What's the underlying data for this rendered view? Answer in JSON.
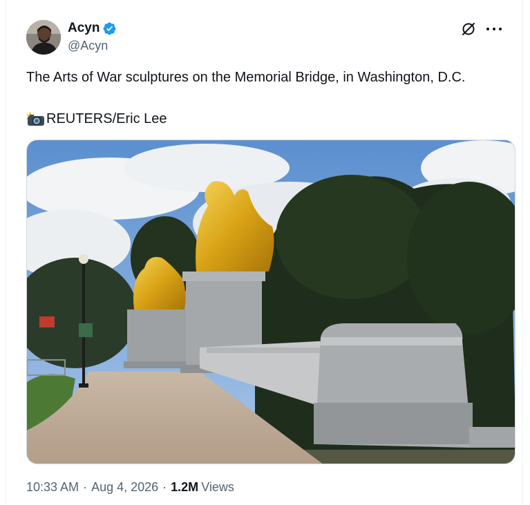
{
  "tweet": {
    "author": {
      "display_name": "Acyn",
      "handle": "@Acyn",
      "verified": true,
      "avatar_icon": "user-avatar"
    },
    "actions": {
      "grok_icon": "grok-slash-icon",
      "more_icon": "more-dots-icon"
    },
    "text": "The Arts of War sculptures on the Memorial Bridge, in Washington, D.C.",
    "credit": "REUTERS/Eric Lee",
    "credit_emoji": "camera-flash-emoji",
    "media": {
      "type": "photo",
      "subject": "gilded-equestrian-statues-bridge"
    },
    "meta": {
      "time": "10:33 AM",
      "separator": "·",
      "date": "Aug 4, 2026",
      "views_count": "1.2M",
      "views_label": "Views"
    },
    "colors": {
      "verified_blue": "#1d9bf0",
      "text_primary": "#0f1419",
      "text_secondary": "#536471",
      "border": "#cfd9de"
    }
  }
}
